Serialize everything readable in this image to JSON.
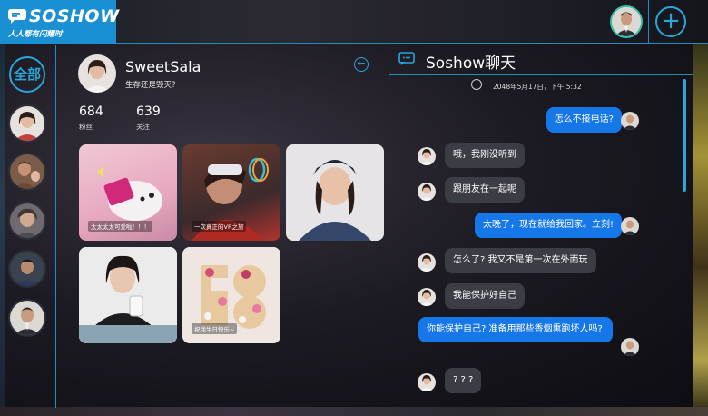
{
  "app": {
    "name": "SOSHOW",
    "slogan": "人人都有闪耀时",
    "add_label": "+"
  },
  "colors": {
    "accent": "#1a8fd2",
    "outgoing_bubble": "#1577e8",
    "incoming_bubble": "#3b3c44",
    "online_ring": "#33c0a8"
  },
  "rail": {
    "all_label": "全部"
  },
  "profile": {
    "name": "SweetSala",
    "bio": "生存还是毁灭?",
    "followers": "684",
    "followers_label": "粉丝",
    "following": "639",
    "following_label": "关注",
    "back_icon": "arrow-left-circle-icon",
    "posts": [
      {
        "caption": "太太太太可爱啦！！！"
      },
      {
        "caption": "一次真正的VR之旅"
      },
      {
        "caption": ""
      },
      {
        "caption": ""
      },
      {
        "caption": "祝我生日快乐~"
      }
    ]
  },
  "chat": {
    "title": "Soshow聊天",
    "timestamp": "2048年5月17日，下午 5:32",
    "messages": [
      {
        "dir": "out",
        "text": "怎么不接电话?"
      },
      {
        "dir": "in",
        "text": "哦，我刚没听到"
      },
      {
        "dir": "in",
        "text": "跟朋友在一起呢"
      },
      {
        "dir": "out",
        "text": "太晚了，现在就给我回家。立刻!"
      },
      {
        "dir": "in",
        "text": "怎么了? 我又不是第一次在外面玩"
      },
      {
        "dir": "in",
        "text": "我能保护好自己"
      },
      {
        "dir": "out",
        "text": "你能保护自己? 准备用那些香烟熏跑坏人吗?"
      },
      {
        "dir": "in",
        "text": "? ? ?"
      }
    ]
  }
}
